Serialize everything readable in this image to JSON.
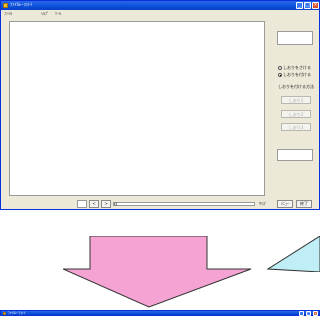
{
  "window": {
    "title": "ﾌｧｲﾙﾚｰﾌｫﾄﾄ",
    "controls": {
      "minimize": "_",
      "maximize": "□",
      "close": "×"
    }
  },
  "menu": [
    "ﾌｧｲﾙ",
    "ﾍﾙﾌﾟ",
    "ﾂｰﾙ"
  ],
  "right_panel": {
    "radio_1": "しおりをさける",
    "radio_2": "しおりを付ける",
    "section_label": "しおりを付ける方法",
    "button_1": "しおり1",
    "button_2": "しおり2",
    "button_3": "しおり3"
  },
  "bottom_bar": {
    "prev_label": "<",
    "next_label": ">",
    "slider_value": 0,
    "status_label": "ｻｲｽﾞ",
    "btn_a": "ﾒﾆｭｰ",
    "btn_b": "終了"
  },
  "window2": {
    "title": "ﾌｧｲﾙﾚｰﾌｫﾄﾄ"
  },
  "colors": {
    "arrow_fill": "#f5a3d3",
    "wedge_fill": "#bfeef7",
    "titlebar": "#0a4fd8"
  }
}
